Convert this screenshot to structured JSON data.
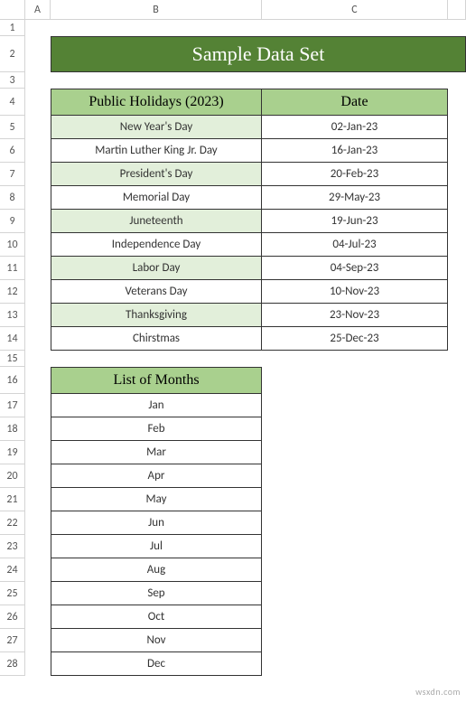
{
  "columns": [
    "A",
    "B",
    "C"
  ],
  "title": "Sample Data Set",
  "holidays": {
    "headers": [
      "Public Holidays (2023)",
      "Date"
    ],
    "rows": [
      {
        "name": "New Year's Day",
        "date": "02-Jan-23"
      },
      {
        "name": "Martin Luther King Jr. Day",
        "date": "16-Jan-23"
      },
      {
        "name": "President's Day",
        "date": "20-Feb-23"
      },
      {
        "name": "Memorial Day",
        "date": "29-May-23"
      },
      {
        "name": "Juneteenth",
        "date": "19-Jun-23"
      },
      {
        "name": "Independence Day",
        "date": "04-Jul-23"
      },
      {
        "name": "Labor Day",
        "date": "04-Sep-23"
      },
      {
        "name": "Veterans Day",
        "date": "10-Nov-23"
      },
      {
        "name": "Thanksgiving",
        "date": "23-Nov-23"
      },
      {
        "name": "Chirstmas",
        "date": "25-Dec-23"
      }
    ]
  },
  "months": {
    "header": "List of Months",
    "list": [
      "Jan",
      "Feb",
      "Mar",
      "Apr",
      "May",
      "Jun",
      "Jul",
      "Aug",
      "Sep",
      "Oct",
      "Nov",
      "Dec"
    ]
  },
  "watermark": "wsxdn.com"
}
